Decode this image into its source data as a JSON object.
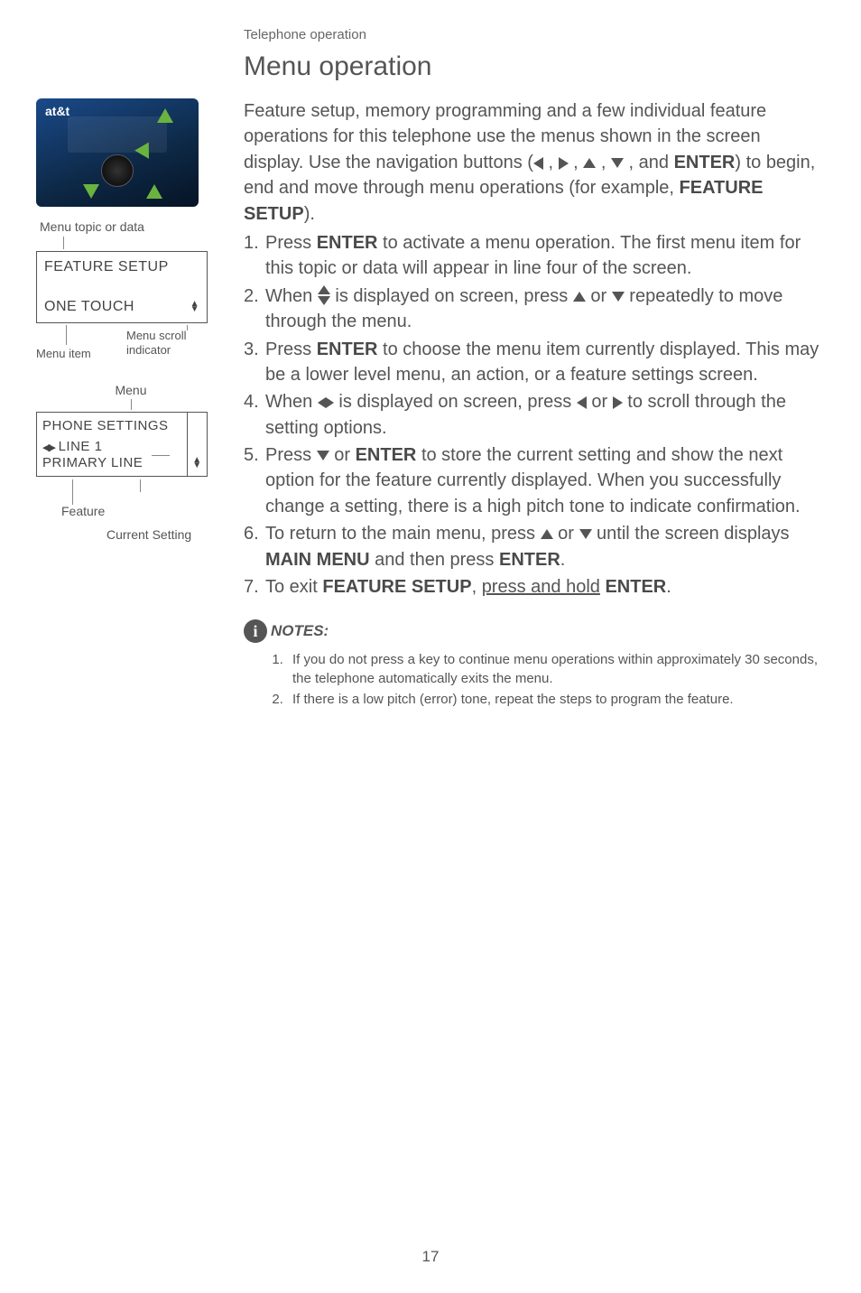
{
  "breadcrumb": "Telephone operation",
  "title": "Menu operation",
  "phone_brand": "at&t",
  "labels": {
    "menu_topic": "Menu topic or data",
    "menu_scroll": "Menu scroll",
    "indicator": "indicator",
    "menu_item": "Menu item",
    "menu": "Menu",
    "feature": "Feature",
    "current_setting": "Current Setting"
  },
  "lcd1": {
    "line1": "FEATURE SETUP",
    "line2": "ONE TOUCH"
  },
  "lcd2": {
    "line1": "PHONE SETTINGS",
    "line2": "LINE 1",
    "line3": "PRIMARY LINE"
  },
  "intro": {
    "p1a": "Feature setup, memory programming and a few individual feature operations for this telephone use the menus shown in the screen display. Use the navigation buttons (",
    "p1b": " , and ",
    "p1c": ") to begin, end and move through menu operations (for example, ",
    "enter": "ENTER",
    "feature_setup": "FEATURE SETUP",
    "p1d": ")."
  },
  "steps": {
    "s1a": "Press ",
    "s1b": " to activate a menu operation. The first menu item for this topic or data will appear in line four of the screen.",
    "s2a": "When ",
    "s2b": " is displayed on screen, press ",
    "s2c": " or ",
    "s2d": " repeatedly to move through the menu.",
    "s3a": "Press ",
    "s3b": " to choose the menu item currently displayed. This may be a lower level menu, an action, or a feature settings screen.",
    "s4a": "When ",
    "s4b": " is displayed on screen, press ",
    "s4c": " or ",
    "s4d": " to scroll through the setting options.",
    "s5a": "Press ",
    "s5b": " or ",
    "s5c": " to store the current setting and show the next option for the feature currently displayed. When you successfully change a setting, there is a high pitch tone to indicate confirmation.",
    "s6a": "To return to the main menu, press ",
    "s6b": " or ",
    "s6c": " until the screen displays ",
    "s6d": " and then press ",
    "main_menu": "MAIN MENU",
    "s7a": "To exit ",
    "s7b": ", ",
    "s7c": "press and hold",
    "s7d": " "
  },
  "notes_label": "NOTES:",
  "notes": {
    "n1": "If you do not press a key to continue menu operations within approximately 30 seconds, the telephone automatically exits the menu.",
    "n2": "If there is a low pitch (error) tone, repeat the steps to program the feature."
  },
  "page_number": "17"
}
